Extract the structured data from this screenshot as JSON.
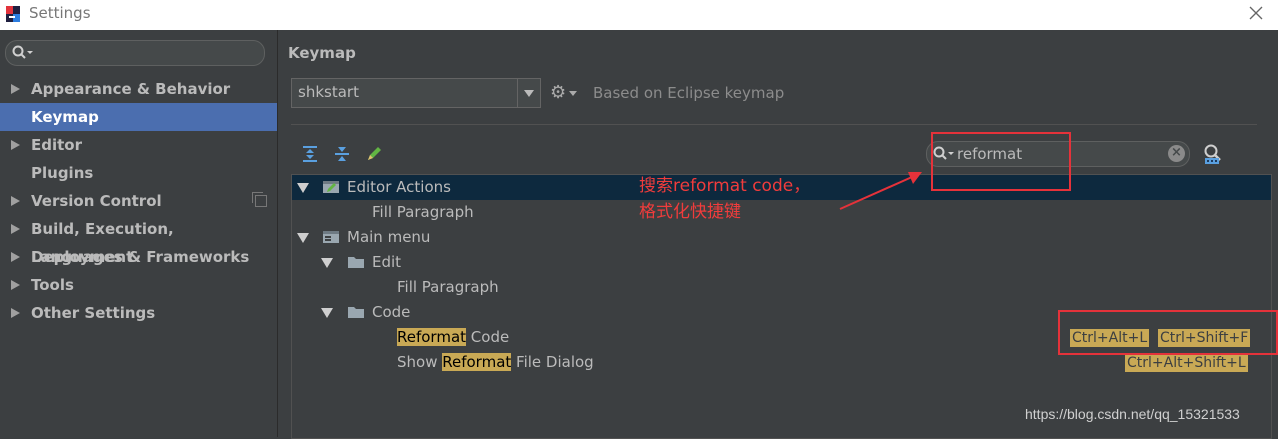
{
  "window": {
    "title": "Settings"
  },
  "sidebar": {
    "search_placeholder": "",
    "items": [
      {
        "label": "Appearance & Behavior",
        "expandable": true
      },
      {
        "label": "Keymap",
        "expandable": false,
        "selected": true
      },
      {
        "label": "Editor",
        "expandable": true
      },
      {
        "label": "Plugins",
        "expandable": false
      },
      {
        "label": "Version Control",
        "expandable": true
      },
      {
        "label": "Build, Execution, Deployment",
        "expandable": true
      },
      {
        "label": "Languages & Frameworks",
        "expandable": true
      },
      {
        "label": "Tools",
        "expandable": true
      },
      {
        "label": "Other Settings",
        "expandable": true
      }
    ]
  },
  "main": {
    "title": "Keymap",
    "keymap_select": {
      "value": "shkstart"
    },
    "based_on": "Based on Eclipse keymap",
    "filter": {
      "value": "reformat"
    }
  },
  "tree": {
    "editor_actions": "Editor Actions",
    "fill_paragraph_1": "Fill Paragraph",
    "main_menu": "Main menu",
    "edit": "Edit",
    "fill_paragraph_2": "Fill Paragraph",
    "code": "Code",
    "reformat_code": {
      "hl": "Reformat",
      "rest": " Code"
    },
    "show_reformat": {
      "pre": "Show ",
      "hl": "Reformat",
      "rest": " File Dialog"
    },
    "shortcuts": {
      "reformat_code_1": "Ctrl+Alt+L",
      "reformat_code_2": "Ctrl+Shift+F",
      "show_reformat": "Ctrl+Alt+Shift+L"
    }
  },
  "annotation": {
    "line1": "搜索reformat code，",
    "line2": "格式化快捷键"
  },
  "watermark": "https://blog.csdn.net/qq_15321533",
  "colors": {
    "accent": "#4b6eaf",
    "highlight": "#c9a955",
    "annotation": "#e5323a"
  }
}
